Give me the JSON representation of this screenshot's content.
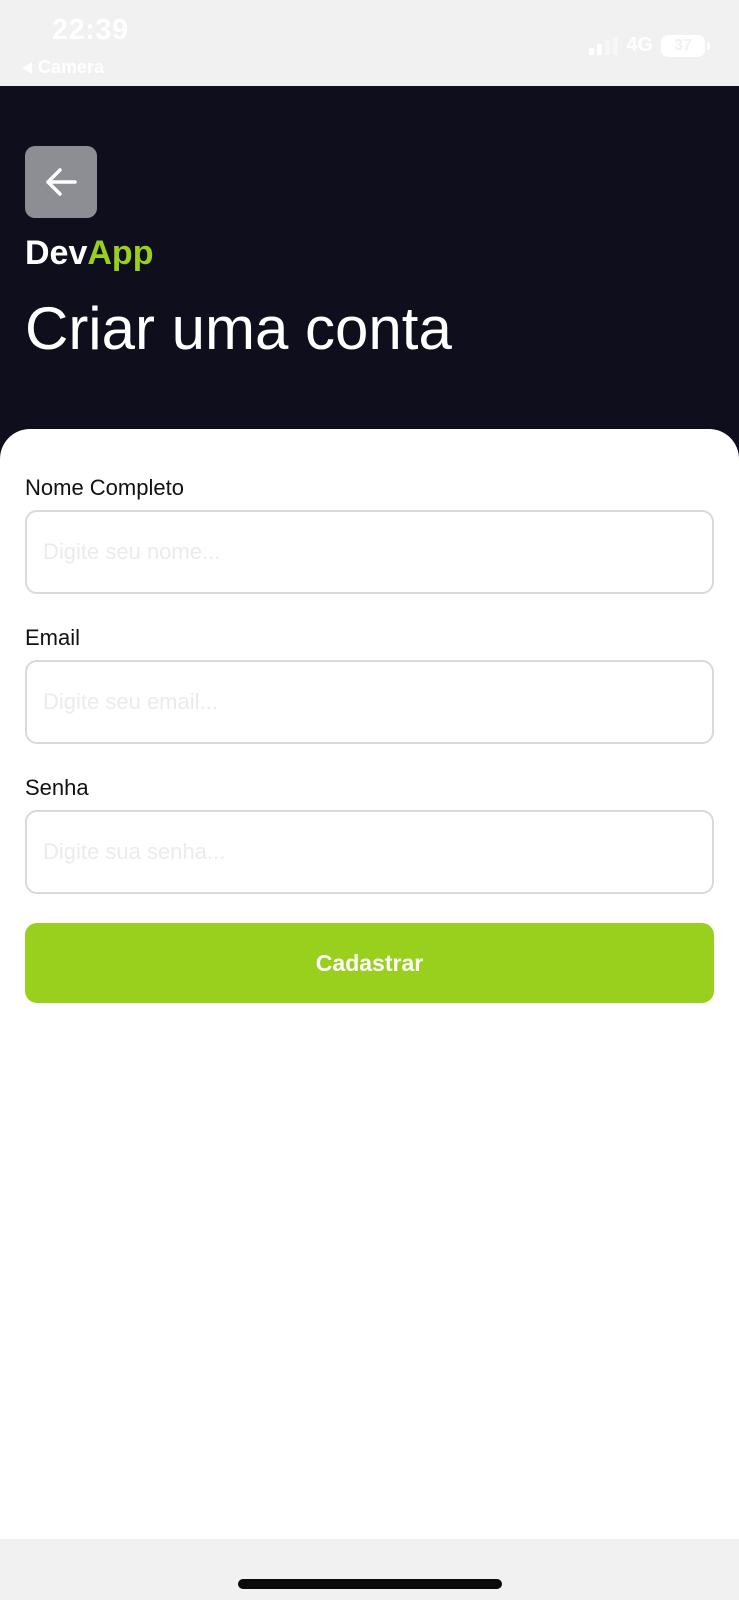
{
  "status_bar": {
    "time": "22:39",
    "back_app": "Camera",
    "network": "4G",
    "battery": "37"
  },
  "header": {
    "back_icon": "arrow-left-icon",
    "brand_primary": "Dev",
    "brand_accent": "App",
    "title": "Criar uma conta"
  },
  "form": {
    "name": {
      "label": "Nome Completo",
      "placeholder": "Digite seu nome...",
      "value": ""
    },
    "email": {
      "label": "Email",
      "placeholder": "Digite seu email...",
      "value": ""
    },
    "password": {
      "label": "Senha",
      "placeholder": "Digite sua senha...",
      "value": ""
    },
    "submit_label": "Cadastrar"
  },
  "colors": {
    "header_bg": "#0e0e1c",
    "accent": "#99d01d",
    "back_button_bg": "#8d8e94"
  }
}
